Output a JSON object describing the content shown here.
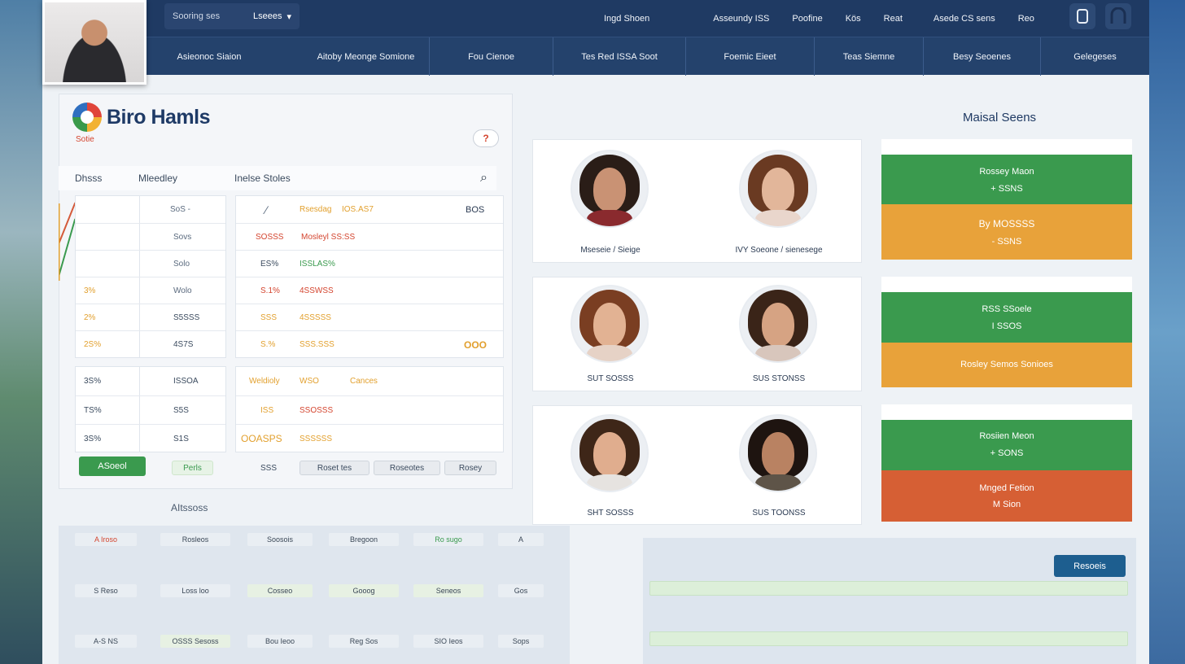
{
  "topbar": {
    "search_label": "Sooring ses",
    "search_select": "Lseees",
    "links": [
      "Ingd Shoen",
      "Asseundy ISS",
      "Poofine",
      "Kös",
      "Reat",
      "Asede CS sens",
      "Reo"
    ]
  },
  "navbar": {
    "tabs": [
      "Asieonoc Siaion",
      "Aitoby Meonge Somione",
      "Fou Cienoe",
      "Tes Red ISSA Soot",
      "Foemic Eieet",
      "Teas Siemne",
      "Besy Seoenes",
      "Gelegeses"
    ]
  },
  "brand": {
    "title": "Biro Hamls",
    "subtitle": "Sotie",
    "help": "?"
  },
  "filters": {
    "a": "Dhsss",
    "b": "Mleedley",
    "c": "Inelse Stoles"
  },
  "left_table": {
    "rows": [
      [
        "",
        "SoS -"
      ],
      [
        "",
        "Sovs"
      ],
      [
        "",
        "Solo"
      ],
      [
        "3%",
        "Wolo"
      ],
      [
        "2%",
        "S5SSS"
      ],
      [
        "2S%",
        "4S7S"
      ]
    ],
    "rows2": [
      [
        "3S%",
        "ISSOA"
      ],
      [
        "TS%",
        "S5S"
      ],
      [
        "3S%",
        "S1S"
      ]
    ]
  },
  "right_table": {
    "rows": [
      [
        "Rsesdag",
        "IOS.AS7",
        "BOS"
      ],
      [
        "SOSSS",
        "Mosleyl SS:SS",
        ""
      ],
      [
        "ES%",
        "ISSLAS%",
        ""
      ],
      [
        "S.1%",
        "4SSWSS",
        ""
      ],
      [
        "SSS",
        "4SSSSS",
        ""
      ],
      [
        "S.%",
        "SSS.SSS",
        "OOO"
      ]
    ],
    "rows2": [
      [
        "Weldioly",
        "WSO",
        "Cances"
      ],
      [
        "ISS",
        "SSOSSS",
        ""
      ],
      [
        "OOASPS",
        "SSSSSS",
        ""
      ]
    ]
  },
  "actions": {
    "add": "ASoeol",
    "small": "Perls",
    "count": "SSS",
    "b1": "Roset tes",
    "b2": "Roseotes",
    "b3": "Rosey"
  },
  "people": [
    [
      "Mseseie / Sieige",
      "IVY Soeone / sienesege"
    ],
    [
      "SUT SOSSS",
      "SUS STONSS"
    ],
    [
      "SHT SOSSS",
      "SUS TOONSS"
    ]
  ],
  "right_panel": {
    "title": "Maisal Seens",
    "cards": [
      {
        "top": "Rossey Maon",
        "top_sub": "+ SSNS",
        "bottom": "By MOSSSS",
        "bottom_sub": "- SSNS"
      },
      {
        "top": "RSS SSoele",
        "top_sub": "I SSOS",
        "bottom": "Rosley Semos Sonioes",
        "bottom_sub": ""
      },
      {
        "top": "Rosiien Meon",
        "top_sub": "+ SONS",
        "bottom": "Mnged Fetion",
        "bottom_sub": "M Sion"
      }
    ]
  },
  "bottom": {
    "label": "AItssoss",
    "grid": [
      [
        "A Iroso",
        "Rosleos",
        "Soosois",
        "Bregoon",
        "Ro sugo",
        "A"
      ],
      [
        "S Reso",
        "Loss loo",
        "Cosseo",
        "Gooog",
        "Seneos",
        "Gos"
      ],
      [
        "A-S NS",
        "OSSS Sesoss",
        "Bou Ieoo",
        "Reg Sos",
        "SIO Ieos",
        "Sops"
      ]
    ],
    "form_button": "Resoeis"
  },
  "colors": {
    "navy": "#1f3a63",
    "green": "#3a9a4e",
    "orange": "#e8a23a",
    "red_orange": "#d65f34",
    "accent_blue": "#1d5e8f"
  }
}
